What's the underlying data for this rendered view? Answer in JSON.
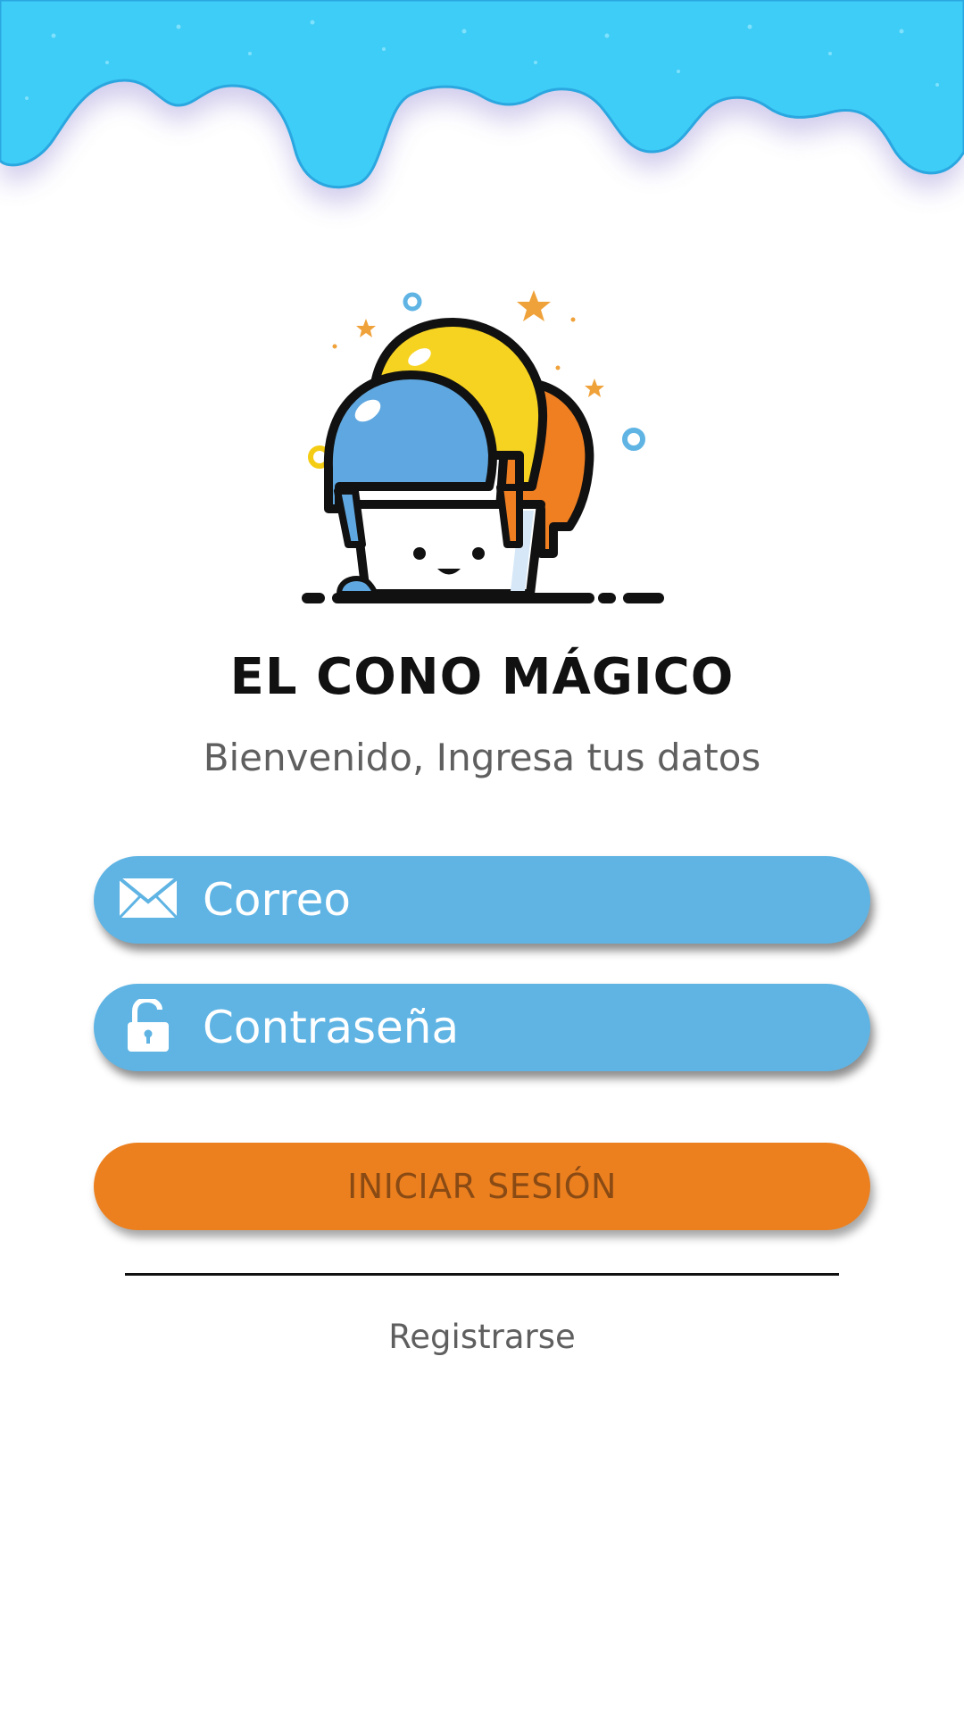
{
  "brand": {
    "name": "EL CONO MÁGICO"
  },
  "welcome": {
    "text": "Bienvenido, Ingresa tus datos"
  },
  "form": {
    "email": {
      "placeholder": "Correo",
      "value": ""
    },
    "password": {
      "placeholder": "Contraseña",
      "value": ""
    },
    "login_label": "INICIAR SESIÓN",
    "register_label": "Registrarse"
  },
  "icons": {
    "email": "envelope-icon",
    "password": "unlocked-padlock-icon",
    "logo": "ice-cream-bucket-logo"
  },
  "colors": {
    "drip": "#3ecdf6",
    "field": "#5fb4e4",
    "button": "#ec801f",
    "button_text": "#8a4a14",
    "muted_text": "#5f5f5f"
  }
}
